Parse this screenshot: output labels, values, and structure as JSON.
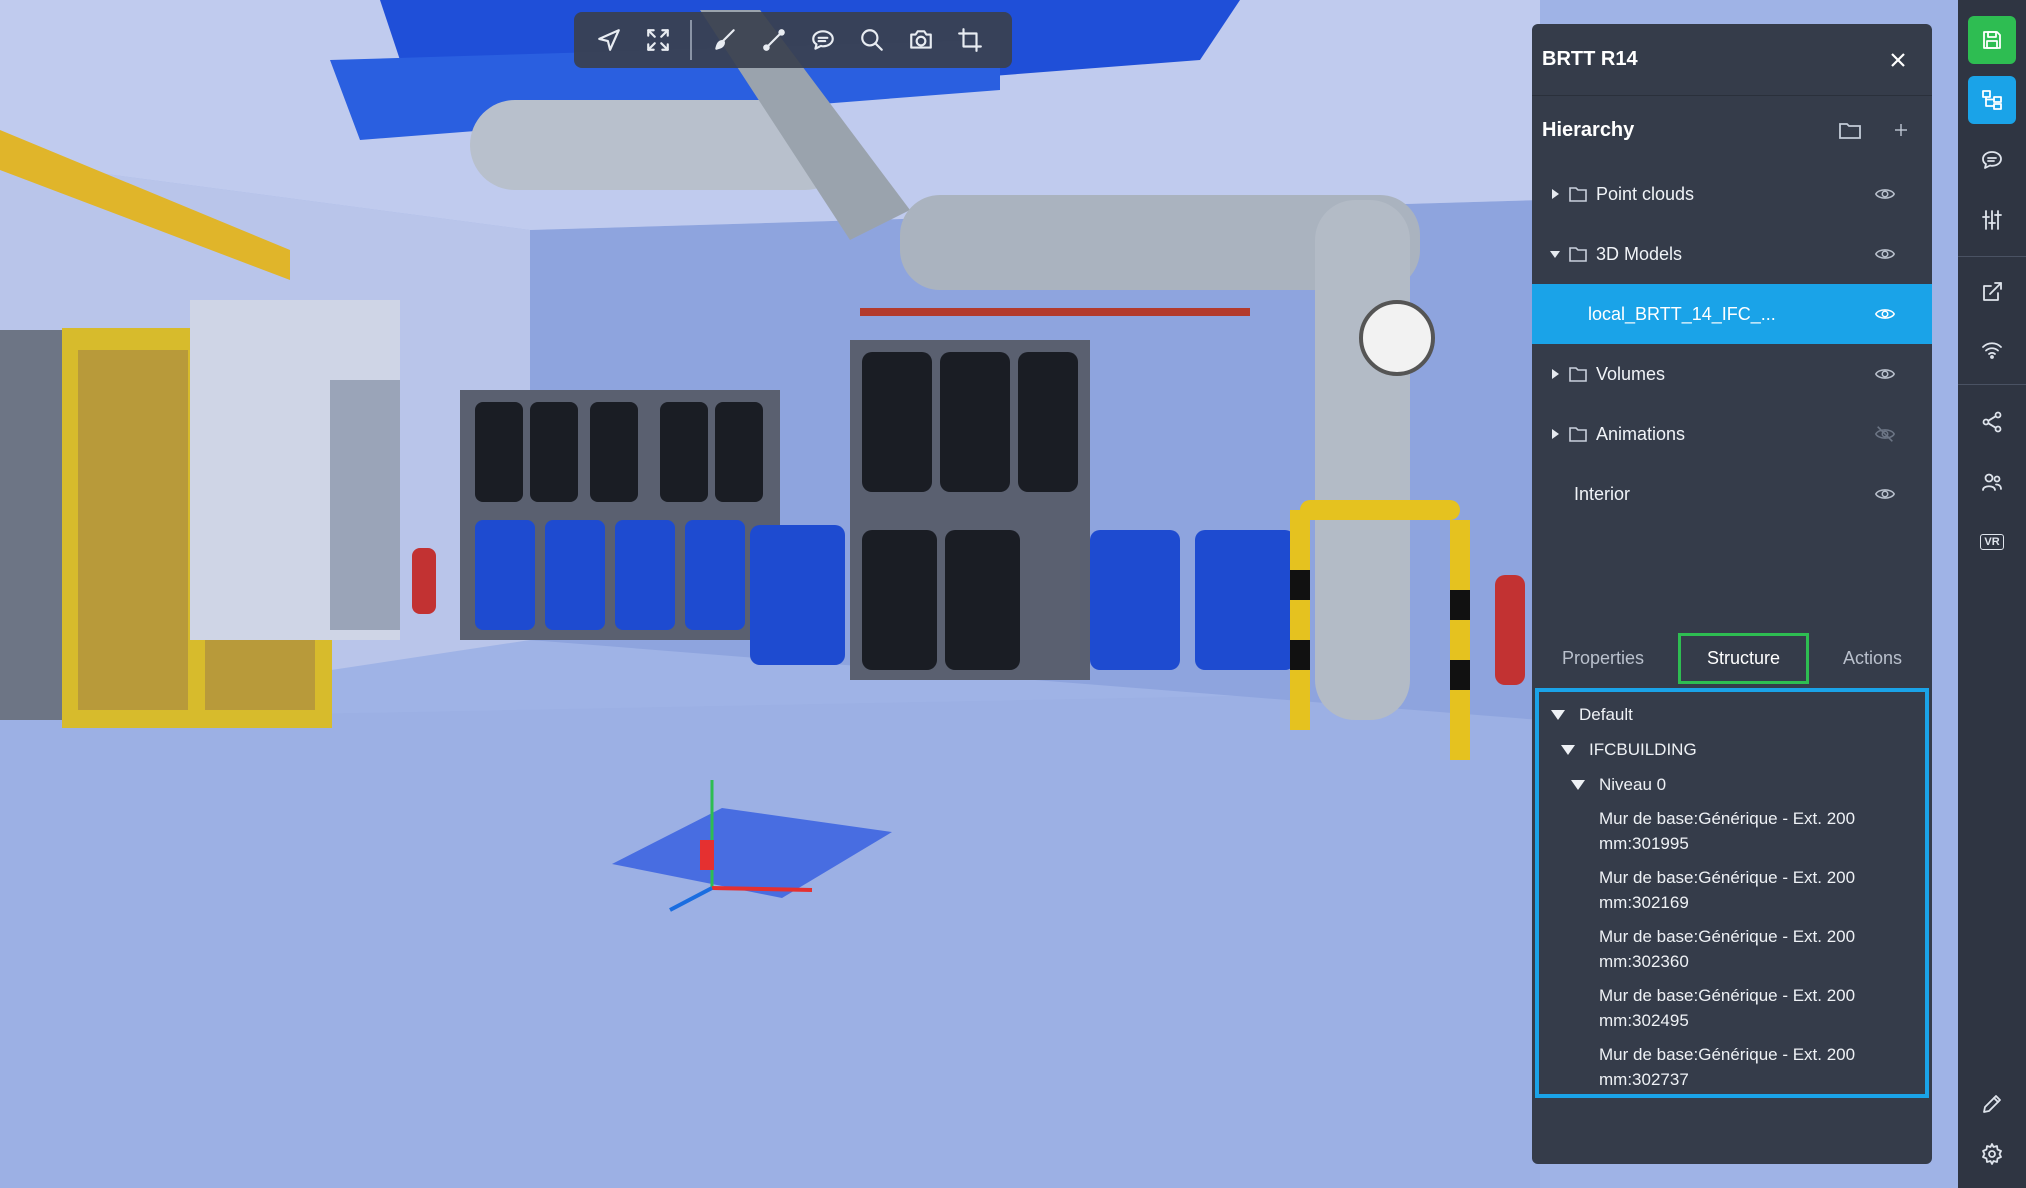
{
  "panel": {
    "title": "BRTT R14",
    "hierarchy_title": "Hierarchy",
    "hierarchy_items": [
      {
        "label": "Point clouds",
        "expanded": false,
        "has_folder": true,
        "visible": true
      },
      {
        "label": "3D Models",
        "expanded": true,
        "has_folder": true,
        "visible": true
      },
      {
        "label": "local_BRTT_14_IFC_...",
        "selected": true,
        "visible": true
      },
      {
        "label": "Volumes",
        "expanded": false,
        "has_folder": true,
        "visible": true
      },
      {
        "label": "Animations",
        "expanded": false,
        "has_folder": true,
        "visible": false
      },
      {
        "label": "Interior",
        "visible": true
      }
    ],
    "tabs": [
      "Properties",
      "Structure",
      "Actions"
    ],
    "active_tab": "Structure",
    "structure": {
      "root": "Default",
      "building": "IFCBUILDING",
      "level": "Niveau 0",
      "items": [
        {
          "line1": "Mur de base:Générique - Ext. 200",
          "line2": "mm:301995"
        },
        {
          "line1": "Mur de base:Générique - Ext. 200",
          "line2": "mm:302169"
        },
        {
          "line1": "Mur de base:Générique - Ext. 200",
          "line2": "mm:302360"
        },
        {
          "line1": "Mur de base:Générique - Ext. 200",
          "line2": "mm:302495"
        },
        {
          "line1": "Mur de base:Générique - Ext. 200",
          "line2": "mm:302737"
        }
      ]
    }
  },
  "toolbar": {
    "icons": [
      "navigate-icon",
      "fullscreen-icon",
      "brush-icon",
      "measure-icon",
      "comment-icon",
      "search-icon",
      "camera-icon",
      "crop-icon"
    ]
  },
  "sidebar": {
    "vr_label": "VR",
    "icons": [
      "save-icon",
      "hierarchy-icon",
      "comment-icon",
      "sliders-icon",
      "external-link-icon",
      "wifi-icon",
      "share-icon",
      "users-icon",
      "vr-icon",
      "edit-icon",
      "settings-icon"
    ]
  },
  "colors": {
    "accent_blue": "#1aa3e8",
    "accent_green": "#2ebd52",
    "panel_bg": "#353c4a",
    "sidebar_bg": "#2f3542"
  }
}
